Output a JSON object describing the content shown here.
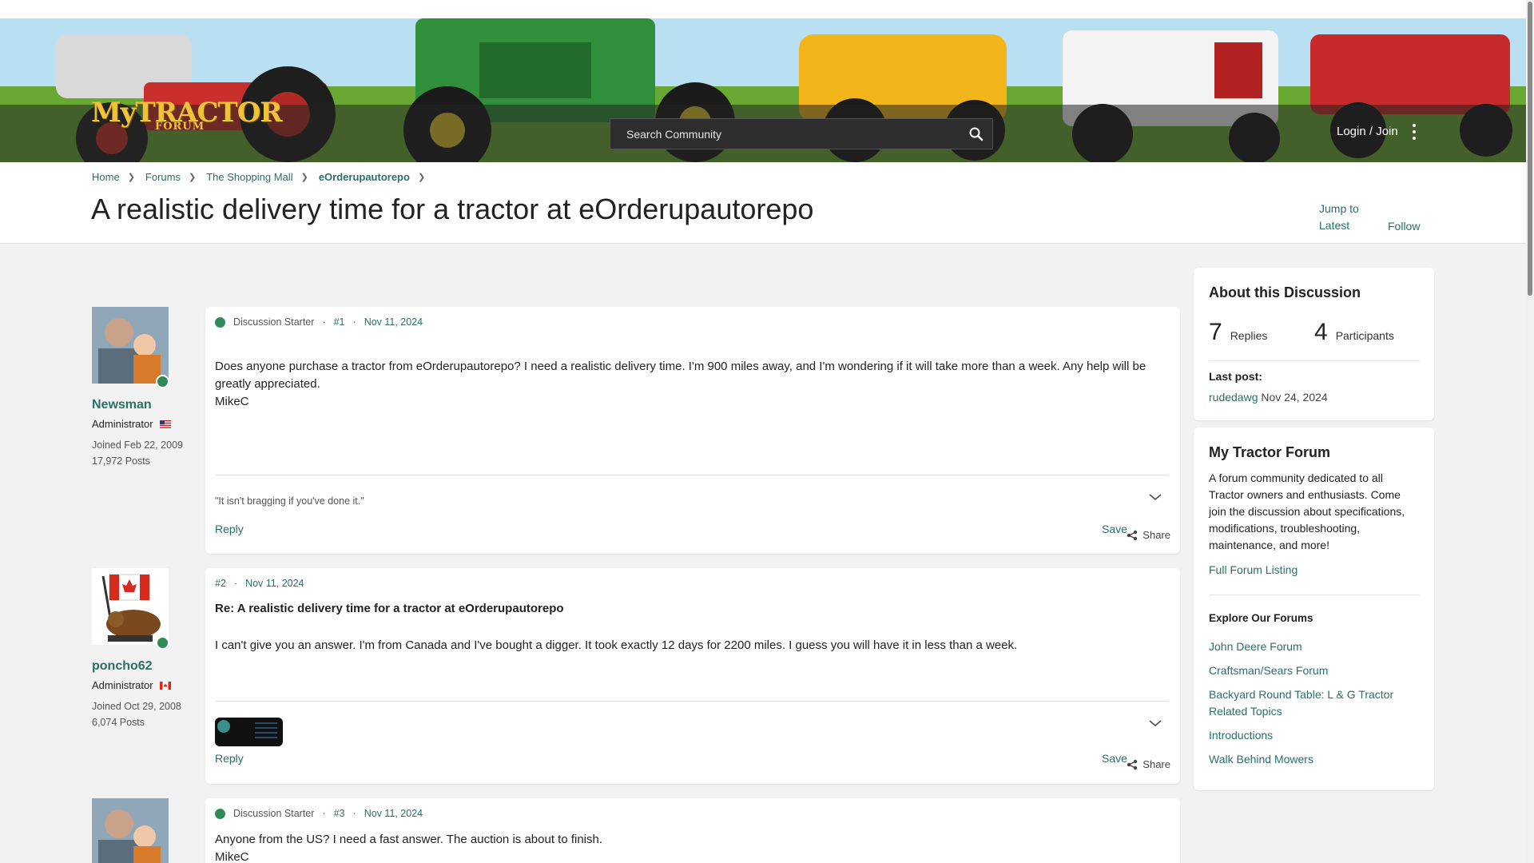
{
  "site": {
    "logo_line1": "MyTRACTOR",
    "logo_line2": "FORUM",
    "login_label": "Login / Join",
    "search_placeholder": "Search Community"
  },
  "breadcrumb": [
    {
      "label": "Home"
    },
    {
      "label": "Forums"
    },
    {
      "label": "The Shopping Mall"
    },
    {
      "label": "eOrderupautorepo"
    }
  ],
  "thread": {
    "title": "A realistic delivery time for a tractor at eOrderupautorepo",
    "jump_label": "Jump to Latest",
    "follow_label": "Follow"
  },
  "posts": [
    {
      "author": "Newsman",
      "role": "Administrator",
      "joined": "Joined Feb 22, 2009",
      "posts": "17,972 Posts",
      "starter_label": "Discussion Starter",
      "number": "#1",
      "date": "Nov 11, 2024",
      "body": "Does anyone purchase a tractor from eOrderupautorepo? I need a realistic delivery time. I'm 900 miles away, and I'm wondering if it will take more than a week. Any help will be greatly appreciated.",
      "body2": "MikeC",
      "signature": "\"It isn't bragging if you've done it.\"",
      "reply": "Reply",
      "save": "Save",
      "share": "Share"
    },
    {
      "author": "poncho62",
      "role": "Administrator",
      "joined": "Joined Oct 29, 2008",
      "posts": "6,074 Posts",
      "number": "#2",
      "date": "Nov 11, 2024",
      "subject": "Re: A realistic delivery time for a tractor at eOrderupautorepo",
      "body": "I can't give you an answer. I'm from Canada and I've bought a digger. It took exactly 12 days for 2200 miles. I guess you will have it in less than a week.",
      "reply": "Reply",
      "save": "Save",
      "share": "Share"
    },
    {
      "starter_label": "Discussion Starter",
      "number": "#3",
      "date": "Nov 11, 2024",
      "body": "Anyone from the US? I need a fast answer. The auction is about to finish.",
      "body2": "MikeC"
    }
  ],
  "about": {
    "title": "About this Discussion",
    "replies_num": "7",
    "replies_label": "Replies",
    "participants_num": "4",
    "participants_label": "Participants",
    "last_post_label": "Last post:",
    "last_post_user": "rudedawg",
    "last_post_date": "Nov 24, 2024"
  },
  "forum_card": {
    "title": "My Tractor Forum",
    "description": "A forum community dedicated to all Tractor owners and enthusiasts. Come join the discussion about specifications, modifications, troubleshooting, maintenance, and more!",
    "full_listing": "Full Forum Listing",
    "explore_label": "Explore Our Forums",
    "forums": [
      "John Deere Forum",
      "Craftsman/Sears Forum",
      "Backyard Round Table: L & G Tractor Related Topics",
      "Introductions",
      "Walk Behind Mowers"
    ]
  },
  "colors": {
    "link": "#2b6f66",
    "badge": "#2e8b57",
    "logo": "#f0c23a"
  }
}
